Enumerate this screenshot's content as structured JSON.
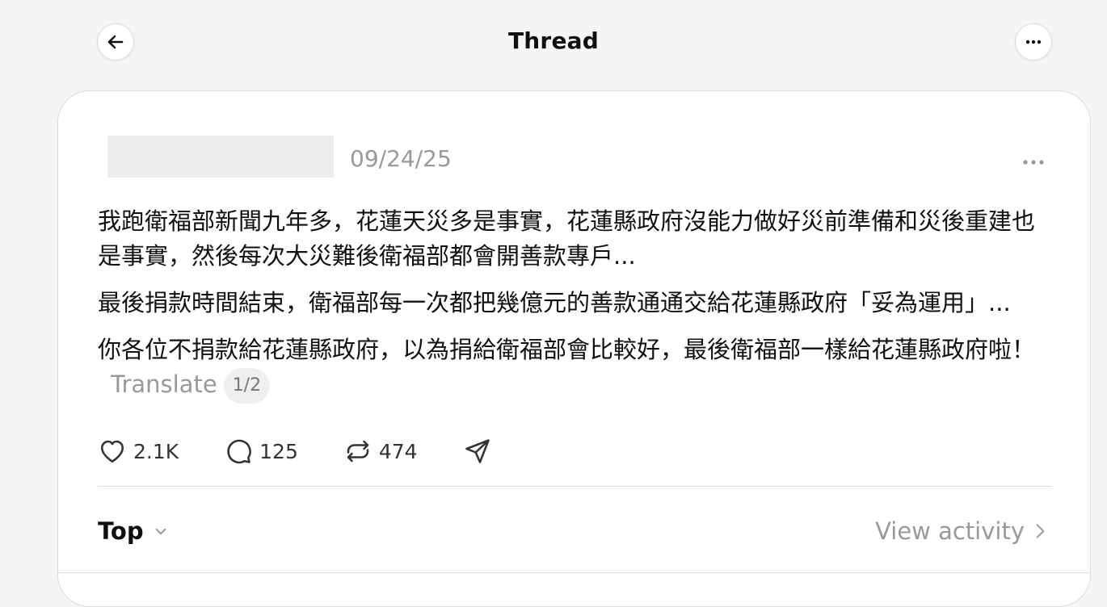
{
  "header": {
    "title": "Thread",
    "back_icon": "arrow-left-icon",
    "more_icon": "more-horizontal-icon"
  },
  "post": {
    "date": "09/24/25",
    "paragraphs": [
      "我跑衛福部新聞九年多，花蓮天災多是事實，花蓮縣政府沒能力做好災前準備和災後重建也是事實，然後每次大災難後衛福部都會開善款專戶...",
      "最後捐款時間結束，衛福部每一次都把幾億元的善款通通交給花蓮縣政府「妥為運用」...",
      "你各位不捐款給花蓮縣政府，以為捐給衛福部會比較好，最後衛福部一樣給花蓮縣政府啦！"
    ],
    "translate_label": "Translate",
    "page_indicator": "1/2",
    "actions": {
      "likes": "2.1K",
      "comments": "125",
      "reposts": "474"
    }
  },
  "footer": {
    "sort_label": "Top",
    "view_activity_label": "View activity"
  },
  "colors": {
    "background": "#f5f5f5",
    "card": "#ffffff",
    "muted_text": "#999999",
    "border": "#dcdcdc"
  }
}
